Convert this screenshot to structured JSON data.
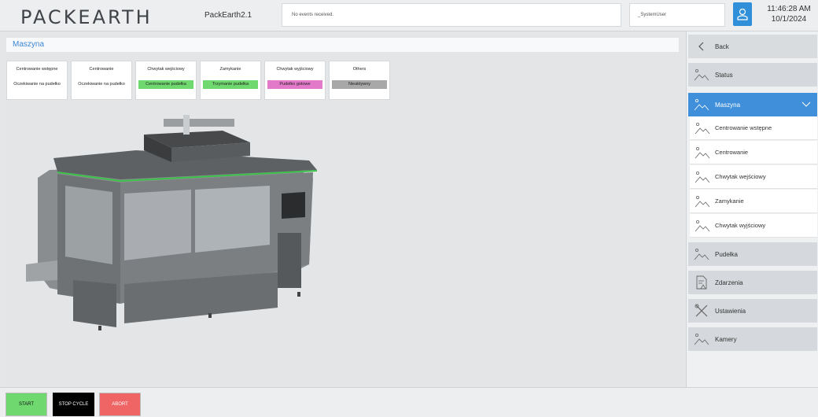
{
  "header": {
    "logo": "PACKEARTH",
    "app_name": "PackEarth2.1",
    "events": "No events received.",
    "user": "_SystemUser",
    "time": "11:46:28 AM",
    "date": "10/1/2024"
  },
  "main": {
    "title": "Maszyna",
    "stations": [
      {
        "name": "Centrowanie wstępne",
        "status": "Oczekiwanie na pudełko",
        "color": "#ffffff"
      },
      {
        "name": "Centrowanie",
        "status": "Oczekiwanie na pudełko",
        "color": "#ffffff"
      },
      {
        "name": "Chwytak wejściowy",
        "status": "Centrowanie pudełka",
        "color": "#6fd86f"
      },
      {
        "name": "Zamykanie",
        "status": "Trzymanie pudełka",
        "color": "#6fd86f"
      },
      {
        "name": "Chwytak wyjściowy",
        "status": "Pudełko gotowe",
        "color": "#e37ac9"
      },
      {
        "name": "Others",
        "status": "Nieaktywny",
        "color": "#a8a8a8"
      }
    ]
  },
  "sidebar": {
    "back": "Back",
    "status": "Status",
    "maszyna": "Maszyna",
    "sub_items": [
      "Centrowanie wstępne",
      "Centrowanie",
      "Chwytak wejściowy",
      "Zamykanie",
      "Chwytak wyjściowy"
    ],
    "pudelka": "Pudełka",
    "zdarzenia": "Zdarzenia",
    "ustawienia": "Ustawienia",
    "kamery": "Kamery"
  },
  "footer": {
    "start": "START",
    "stop_cycle": "STOP CYCLE",
    "abort": "ABORT"
  },
  "colors": {
    "accent": "#3f8fdb",
    "start": "#6fd86f",
    "stop": "#000000",
    "abort": "#ef6464"
  }
}
